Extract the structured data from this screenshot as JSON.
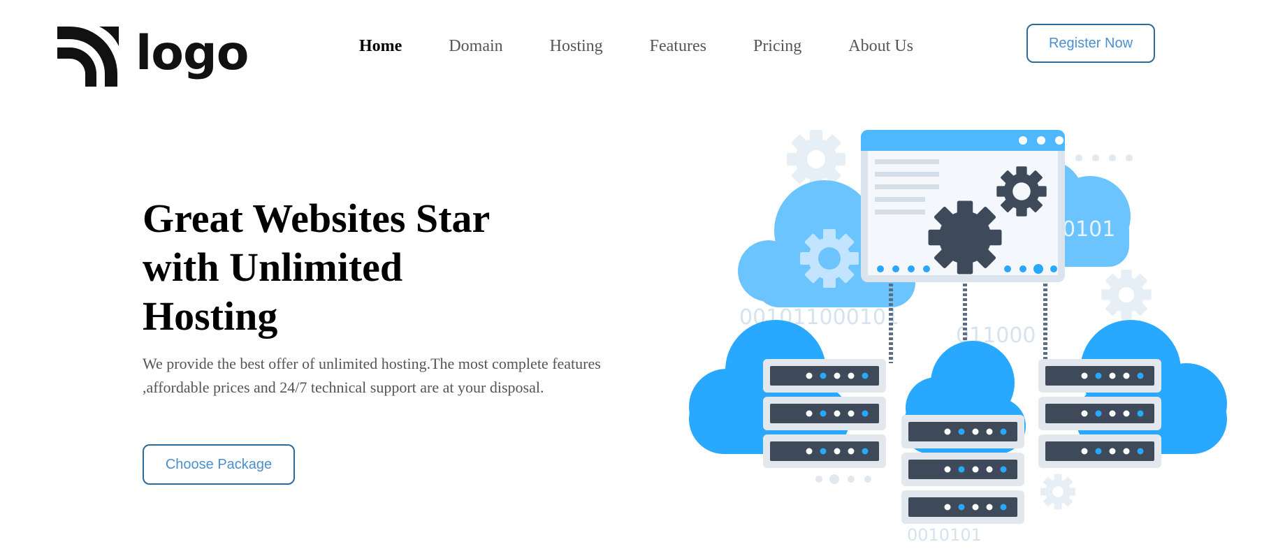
{
  "header": {
    "logo_text": "logo",
    "nav": [
      {
        "label": "Home",
        "active": true
      },
      {
        "label": "Domain",
        "active": false
      },
      {
        "label": "Hosting",
        "active": false
      },
      {
        "label": "Features",
        "active": false
      },
      {
        "label": "Pricing",
        "active": false
      },
      {
        "label": "About Us",
        "active": false
      }
    ],
    "register_label": "Register Now"
  },
  "hero": {
    "title": "Great Websites Star with Unlimited Hosting",
    "description": "We provide the best offer of unlimited hosting.The most complete features ,affordable prices and 24/7 technical support are at your disposal.",
    "cta_label": "Choose Package"
  },
  "illustration": {
    "binary_1": "001011000101",
    "binary_2": "011000",
    "binary_3": "0101",
    "binary_4": "0010101"
  },
  "colors": {
    "accent": "#4a8fd0",
    "button_border": "#2d6a9a",
    "cloud_blue": "#29a8ff",
    "cloud_light": "#6cc4ff",
    "server_dark": "#3e4a5a",
    "gear_light": "#e6eef6"
  }
}
